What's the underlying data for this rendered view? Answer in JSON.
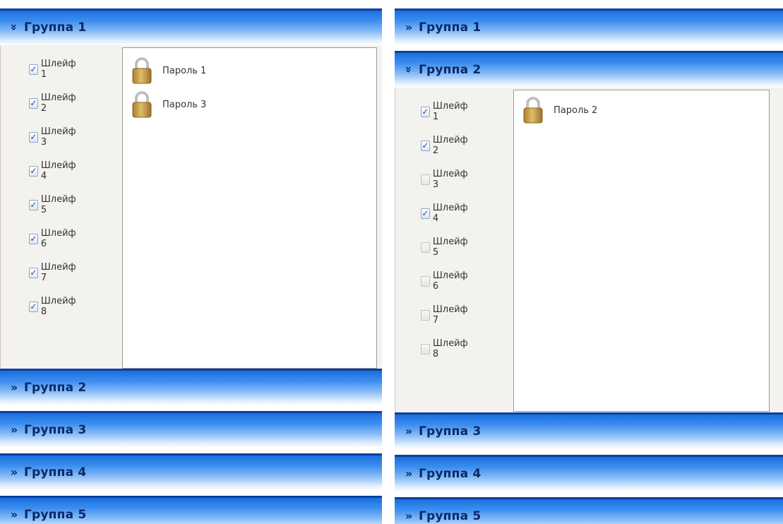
{
  "left": {
    "expanded_group": {
      "title": "Группа 1",
      "chevron": "double-chevron-down",
      "zones": [
        {
          "label": "Шлейф 1",
          "checked": true
        },
        {
          "label": "Шлейф 2",
          "checked": true
        },
        {
          "label": "Шлейф 3",
          "checked": true
        },
        {
          "label": "Шлейф 4",
          "checked": true
        },
        {
          "label": "Шлейф 5",
          "checked": true
        },
        {
          "label": "Шлейф 6",
          "checked": true
        },
        {
          "label": "Шлейф 7",
          "checked": true
        },
        {
          "label": "Шлейф 8",
          "checked": true
        }
      ],
      "passwords": [
        {
          "label": "Пароль 1",
          "icon": "lock-icon"
        },
        {
          "label": "Пароль 3",
          "icon": "lock-icon"
        }
      ]
    },
    "collapsed_groups": [
      {
        "title": "Группа 2",
        "chevron": "double-chevron-right"
      },
      {
        "title": "Группа 3",
        "chevron": "double-chevron-right"
      },
      {
        "title": "Группа 4",
        "chevron": "double-chevron-right"
      },
      {
        "title": "Группа 5",
        "chevron": "double-chevron-right"
      }
    ]
  },
  "right": {
    "groups_above": [
      {
        "title": "Группа 1",
        "chevron": "double-chevron-right"
      }
    ],
    "expanded_group": {
      "title": "Группа 2",
      "chevron": "double-chevron-down",
      "zones": [
        {
          "label": "Шлейф 1",
          "checked": true
        },
        {
          "label": "Шлейф 2",
          "checked": true
        },
        {
          "label": "Шлейф 3",
          "checked": false
        },
        {
          "label": "Шлейф 4",
          "checked": true
        },
        {
          "label": "Шлейф 5",
          "checked": false
        },
        {
          "label": "Шлейф 6",
          "checked": false
        },
        {
          "label": "Шлейф 7",
          "checked": false
        },
        {
          "label": "Шлейф 8",
          "checked": false
        }
      ],
      "passwords": [
        {
          "label": "Пароль 2",
          "icon": "lock-icon"
        }
      ]
    },
    "collapsed_groups": [
      {
        "title": "Группа 3",
        "chevron": "double-chevron-right"
      },
      {
        "title": "Группа 4",
        "chevron": "double-chevron-right"
      },
      {
        "title": "Группа 5",
        "chevron": "double-chevron-right"
      }
    ]
  },
  "colors": {
    "header_top": "#1a6fdc",
    "header_text": "#0a2a66",
    "body_bg": "#f3f2ee",
    "checkmark": "#1b4aa8"
  }
}
